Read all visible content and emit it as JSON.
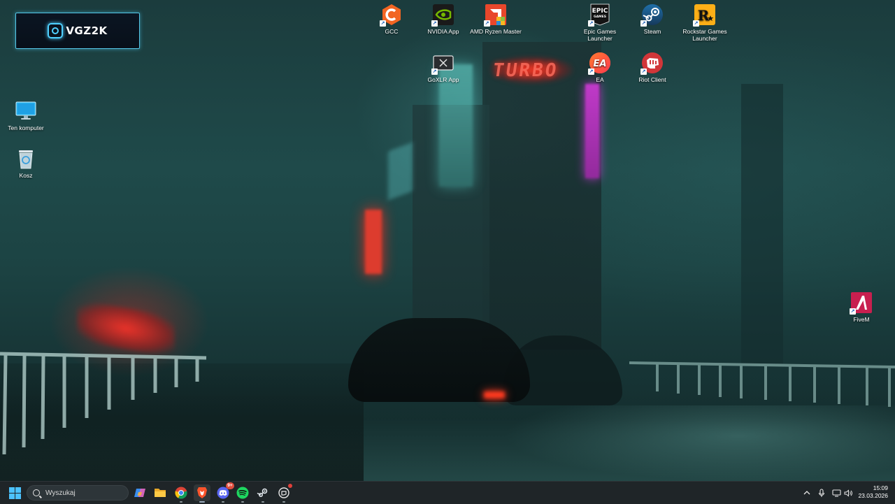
{
  "widget": {
    "brand": "VGZ2K"
  },
  "desktop": {
    "left_icons": [
      {
        "label": "Ten komputer",
        "icon": "monitor-icon"
      },
      {
        "label": "Kosz",
        "icon": "recycle-bin-icon"
      }
    ],
    "top_icons": [
      {
        "label": "GCC",
        "icon": "gcc-icon"
      },
      {
        "label": "NVIDIA App",
        "icon": "nvidia-icon"
      },
      {
        "label": "AMD Ryzen Master",
        "icon": "amd-icon"
      },
      {
        "label": "Epic Games Launcher",
        "icon": "epic-games-icon",
        "logo": "EPIC\nGAMES"
      },
      {
        "label": "Steam",
        "icon": "steam-icon"
      },
      {
        "label": "Rockstar Games Launcher",
        "icon": "rockstar-icon",
        "logo": "R"
      },
      {
        "label": "GoXLR App",
        "icon": "goxlr-icon"
      },
      {
        "label": "EA",
        "icon": "ea-icon",
        "logo": "EA"
      },
      {
        "label": "Riot Client",
        "icon": "riot-client-icon"
      },
      {
        "label": "FiveM",
        "icon": "fivem-icon"
      }
    ]
  },
  "wallpaper": {
    "sign_text": "TURBO"
  },
  "taskbar": {
    "search_placeholder": "Wyszukaj",
    "apps": [
      {
        "name": "copilot",
        "icon": "copilot-icon"
      },
      {
        "name": "file-explorer",
        "icon": "folder-icon"
      },
      {
        "name": "chrome",
        "icon": "chrome-icon"
      },
      {
        "name": "brave",
        "icon": "brave-icon"
      },
      {
        "name": "discord",
        "icon": "discord-icon",
        "badge": "9+"
      },
      {
        "name": "spotify",
        "icon": "spotify-icon"
      },
      {
        "name": "steam",
        "icon": "steam-icon"
      },
      {
        "name": "riot",
        "icon": "riot-icon"
      }
    ],
    "clock": {
      "time": "15:09",
      "date": "23.03.2026"
    }
  },
  "colors": {
    "taskbar_bg": "#1f2528",
    "accent_cyan": "#4fd0ff",
    "neon_red": "#ff3b2b",
    "neon_purple": "#c23bd0"
  }
}
